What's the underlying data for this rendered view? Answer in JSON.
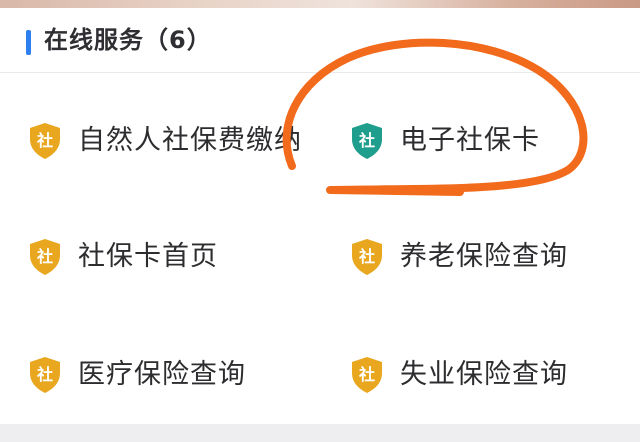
{
  "header": {
    "title": "在线服务（6）",
    "accent_color": "#2d7ff0"
  },
  "services": [
    {
      "label": "自然人社保费缴纳",
      "icon": "social-security-shield-icon",
      "icon_color": "#e8a71e",
      "icon_glyph": "社"
    },
    {
      "label": "电子社保卡",
      "icon": "social-security-shield-icon",
      "icon_color": "#1f9e8e",
      "icon_glyph": "社"
    },
    {
      "label": "社保卡首页",
      "icon": "social-security-shield-icon",
      "icon_color": "#e8a71e",
      "icon_glyph": "社"
    },
    {
      "label": "养老保险查询",
      "icon": "social-security-shield-icon",
      "icon_color": "#e8a71e",
      "icon_glyph": "社"
    },
    {
      "label": "医疗保险查询",
      "icon": "social-security-shield-icon",
      "icon_color": "#e8a71e",
      "icon_glyph": "社"
    },
    {
      "label": "失业保险查询",
      "icon": "social-security-shield-icon",
      "icon_color": "#e8a71e",
      "icon_glyph": "社"
    }
  ],
  "annotation": {
    "color": "#f26a1b",
    "target": "电子社保卡"
  }
}
